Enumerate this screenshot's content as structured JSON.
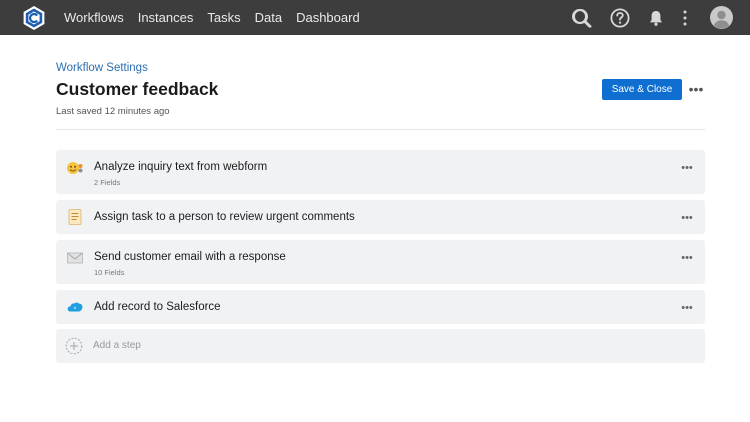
{
  "nav": {
    "items": [
      {
        "label": "Workflows"
      },
      {
        "label": "Instances"
      },
      {
        "label": "Tasks"
      },
      {
        "label": "Data"
      },
      {
        "label": "Dashboard"
      }
    ],
    "icons": [
      "search-icon",
      "help-icon",
      "bell-icon",
      "kebab-menu-icon",
      "user-avatar"
    ]
  },
  "header": {
    "breadcrumb": "Workflow Settings",
    "title": "Customer feedback",
    "last_saved": "Last saved 12 minutes ago",
    "save_label": "Save & Close",
    "more": "•••"
  },
  "steps": [
    {
      "title": "Analyze inquiry text from webform",
      "sub": "2 Fields",
      "icon": "emoji-analysis-icon",
      "more": "•••"
    },
    {
      "title": "Assign task to a person to review urgent comments",
      "sub": "",
      "icon": "task-document-icon",
      "more": "•••"
    },
    {
      "title": "Send customer email with a response",
      "sub": "10 Fields",
      "icon": "envelope-icon",
      "more": "•••"
    },
    {
      "title": "Add record to Salesforce",
      "sub": "",
      "icon": "salesforce-cloud-icon",
      "more": "•••"
    }
  ],
  "add_step": {
    "label": "Add a step"
  },
  "colors": {
    "topbar": "#3d3d3d",
    "accent": "#0f6fd1",
    "link": "#2c6fb1",
    "step_bg": "#f1f2f4"
  }
}
